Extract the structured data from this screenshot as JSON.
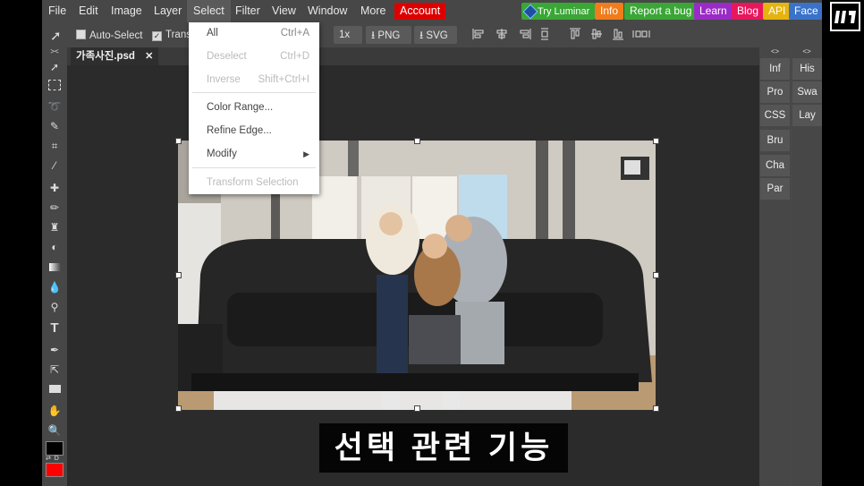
{
  "menubar": {
    "items": [
      "File",
      "Edit",
      "Image",
      "Layer",
      "Select",
      "Filter",
      "View",
      "Window",
      "More"
    ],
    "account": "Account",
    "try_luminar": "Try Luminar",
    "pills": [
      {
        "label": "Info",
        "color": "#f07c1c"
      },
      {
        "label": "Report a bug",
        "color": "#3aa636"
      },
      {
        "label": "Learn",
        "color": "#9b2bc7"
      },
      {
        "label": "Blog",
        "color": "#e8175d"
      },
      {
        "label": "API",
        "color": "#e6b40f"
      },
      {
        "label": "Face",
        "color": "#3a72c9"
      }
    ]
  },
  "options": {
    "auto_select": "Auto-Select",
    "transform": "Trans",
    "zoom": "1x",
    "png": "PNG",
    "svg": "SVG"
  },
  "document": {
    "tab_name": "가족사진.psd",
    "close_glyph": "✕"
  },
  "caption": "선택 관련 기능",
  "select_menu": [
    {
      "label": "All",
      "shortcut": "Ctrl+A",
      "enabled": true
    },
    {
      "label": "Deselect",
      "shortcut": "Ctrl+D",
      "enabled": false
    },
    {
      "label": "Inverse",
      "shortcut": "Shift+Ctrl+I",
      "enabled": false
    },
    {
      "label": "Color Range...",
      "shortcut": "",
      "enabled": true
    },
    {
      "label": "Refine Edge...",
      "shortcut": "",
      "enabled": true
    },
    {
      "label": "Modify",
      "shortcut": "▶",
      "enabled": true
    },
    {
      "label": "Transform Selection",
      "shortcut": "",
      "enabled": false
    }
  ],
  "panels": {
    "left": [
      "Inf",
      "Pro",
      "CSS",
      "Bru",
      "Cha",
      "Par"
    ],
    "right": [
      "His",
      "Swa",
      "Lay"
    ],
    "collapse_glyph": "<>"
  },
  "toolbar": {
    "collapse_glyph": "><",
    "swap_colors_label": "⇄ D",
    "foreground_color": "#000000",
    "background_color": "#ff0000"
  },
  "colors": {
    "accent_red": "#dd0000",
    "workspace": "#2b2b2b",
    "panel": "#474747"
  }
}
